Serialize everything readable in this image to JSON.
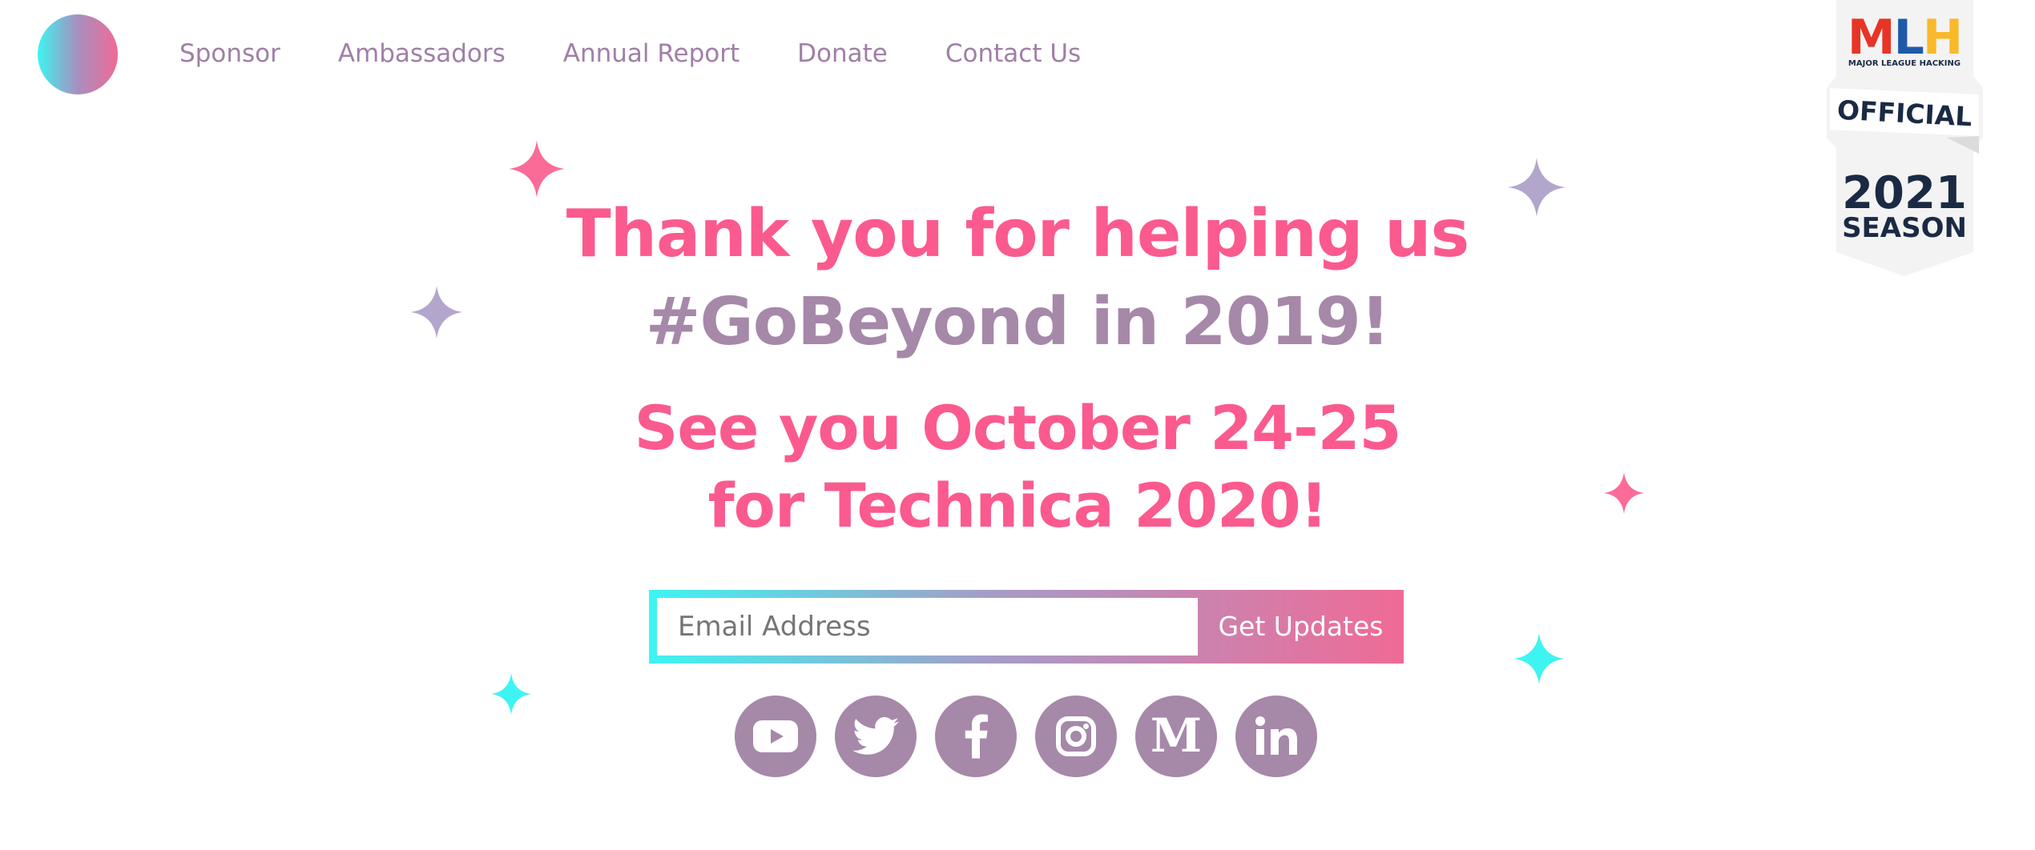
{
  "nav": {
    "items": [
      {
        "label": "Sponsor"
      },
      {
        "label": "Ambassadors"
      },
      {
        "label": "Annual Report"
      },
      {
        "label": "Donate"
      },
      {
        "label": "Contact Us"
      }
    ]
  },
  "mlh_badge": {
    "letters": "MLH",
    "subtitle": "MAJOR LEAGUE HACKING",
    "ribbon": "OFFICIAL",
    "year": "2021",
    "season": "SEASON"
  },
  "hero": {
    "line1": "Thank you for helping us",
    "line2": "#GoBeyond in 2019!",
    "line3": "See you October 24-25",
    "line4": "for Technica 2020!"
  },
  "signup": {
    "email_placeholder": "Email Address",
    "email_value": "",
    "button_label": "Get Updates"
  },
  "socials": [
    {
      "icon": "youtube-icon"
    },
    {
      "icon": "twitter-icon"
    },
    {
      "icon": "facebook-icon"
    },
    {
      "icon": "instagram-icon"
    },
    {
      "icon": "medium-icon"
    },
    {
      "icon": "linkedin-icon"
    }
  ],
  "colors": {
    "pink": "#fb5a8e",
    "mauve": "#a688a9",
    "cyan": "#3ef4f2",
    "lavender": "#b3a6cc"
  }
}
